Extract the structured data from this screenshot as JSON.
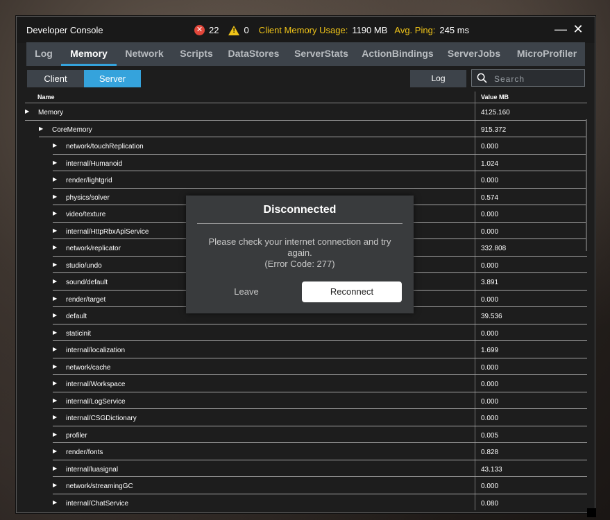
{
  "window": {
    "title": "Developer Console",
    "error_count": "22",
    "warning_count": "0",
    "memory_label": "Client Memory Usage:",
    "memory_value": "1190 MB",
    "ping_label": "Avg. Ping:",
    "ping_value": "245 ms",
    "minimize_glyph": "—",
    "close_glyph": "✕"
  },
  "tabs": [
    {
      "label": "Log",
      "active": false
    },
    {
      "label": "Memory",
      "active": true
    },
    {
      "label": "Network",
      "active": false
    },
    {
      "label": "Scripts",
      "active": false
    },
    {
      "label": "DataStores",
      "active": false
    },
    {
      "label": "ServerStats",
      "active": false
    },
    {
      "label": "ActionBindings",
      "active": false
    },
    {
      "label": "ServerJobs",
      "active": false
    },
    {
      "label": "MicroProfiler",
      "active": false
    }
  ],
  "toolbar": {
    "client_label": "Client",
    "server_label": "Server",
    "log_label": "Log",
    "search_placeholder": "Search"
  },
  "table": {
    "col_name": "Name",
    "col_value": "Value MB",
    "rows": [
      {
        "name": "Memory",
        "value": "4125.160",
        "level": 0
      },
      {
        "name": "CoreMemory",
        "value": "915.372",
        "level": 1
      },
      {
        "name": "network/touchReplication",
        "value": "0.000",
        "level": 2
      },
      {
        "name": "internal/Humanoid",
        "value": "1.024",
        "level": 2
      },
      {
        "name": "render/lightgrid",
        "value": "0.000",
        "level": 2
      },
      {
        "name": "physics/solver",
        "value": "0.574",
        "level": 2
      },
      {
        "name": "video/texture",
        "value": "0.000",
        "level": 2
      },
      {
        "name": "internal/HttpRbxApiService",
        "value": "0.000",
        "level": 2
      },
      {
        "name": "network/replicator",
        "value": "332.808",
        "level": 2
      },
      {
        "name": "studio/undo",
        "value": "0.000",
        "level": 2
      },
      {
        "name": "sound/default",
        "value": "3.891",
        "level": 2
      },
      {
        "name": "render/target",
        "value": "0.000",
        "level": 2
      },
      {
        "name": "default",
        "value": "39.536",
        "level": 2
      },
      {
        "name": "staticinit",
        "value": "0.000",
        "level": 2
      },
      {
        "name": "internal/localization",
        "value": "1.699",
        "level": 2
      },
      {
        "name": "network/cache",
        "value": "0.000",
        "level": 2
      },
      {
        "name": "internal/Workspace",
        "value": "0.000",
        "level": 2
      },
      {
        "name": "internal/LogService",
        "value": "0.000",
        "level": 2
      },
      {
        "name": "internal/CSGDictionary",
        "value": "0.000",
        "level": 2
      },
      {
        "name": "profiler",
        "value": "0.005",
        "level": 2
      },
      {
        "name": "render/fonts",
        "value": "0.828",
        "level": 2
      },
      {
        "name": "internal/luasignal",
        "value": "43.133",
        "level": 2
      },
      {
        "name": "network/streamingGC",
        "value": "0.000",
        "level": 2
      },
      {
        "name": "internal/ChatService",
        "value": "0.080",
        "level": 2
      }
    ]
  },
  "modal": {
    "title": "Disconnected",
    "message": "Please check your internet connection and try again.",
    "error_code": "(Error Code: 277)",
    "leave_label": "Leave",
    "reconnect_label": "Reconnect"
  },
  "colors": {
    "accent": "#35a3dc",
    "warning": "#f0c419",
    "error": "#e2463a"
  }
}
